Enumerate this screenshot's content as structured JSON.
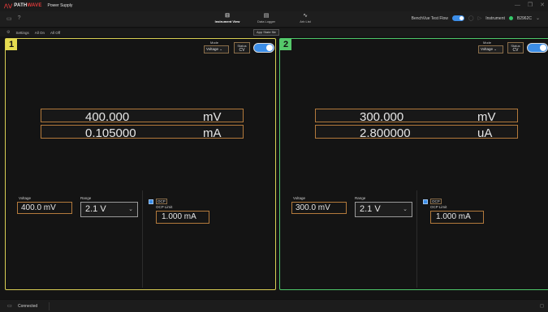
{
  "app": {
    "brand_path": "PATH",
    "brand_wave": "WAVE",
    "title": "Power Supply"
  },
  "window_controls": {
    "minimize": "—",
    "restore": "❐",
    "close": "✕"
  },
  "toolbar": {
    "left_icons": [
      "folder-icon",
      "help-icon"
    ],
    "views": [
      {
        "label": "Instrument View",
        "icon": "instrument-view-icon",
        "active": true
      },
      {
        "label": "Data Logger",
        "icon": "data-logger-icon",
        "active": false
      },
      {
        "label": "Arb List",
        "icon": "arb-list-icon",
        "active": false
      }
    ],
    "benchvue_label": "BenchVue Test Flow",
    "instrument_label": "Instrument",
    "instrument_model": "B2962C"
  },
  "menu": {
    "settings": "Settings",
    "all_on": "All On",
    "all_off": "All Off",
    "app_state": "App State file"
  },
  "channels": [
    {
      "number": "1",
      "accent": "#e6dc50",
      "mode_label": "Mode",
      "mode_value": "Voltage",
      "status_label": "Status",
      "status_value": "CV",
      "output_on": true,
      "readout_voltage": "400.000",
      "readout_voltage_unit": "mV",
      "readout_current": "0.105000",
      "readout_current_unit": "mA",
      "voltage_label": "Voltage",
      "voltage_value": "400.0 mV",
      "range_label": "Range",
      "range_value": "2.1 V",
      "ocp_label": "OCP",
      "ocp_checked": true,
      "ocp_limit_label": "OCP Limit",
      "ocp_limit_value": "1.000 mA"
    },
    {
      "number": "2",
      "accent": "#55c86a",
      "mode_label": "Mode",
      "mode_value": "Voltage",
      "status_label": "Status",
      "status_value": "CV",
      "output_on": true,
      "readout_voltage": "300.000",
      "readout_voltage_unit": "mV",
      "readout_current": "2.800000",
      "readout_current_unit": "uA",
      "voltage_label": "Voltage",
      "voltage_value": "300.0 mV",
      "range_label": "Range",
      "range_value": "2.1 V",
      "ocp_label": "OCP",
      "ocp_checked": true,
      "ocp_limit_label": "OCP Limit",
      "ocp_limit_value": "1.000 mA"
    }
  ],
  "statusbar": {
    "connection": "Connected"
  }
}
